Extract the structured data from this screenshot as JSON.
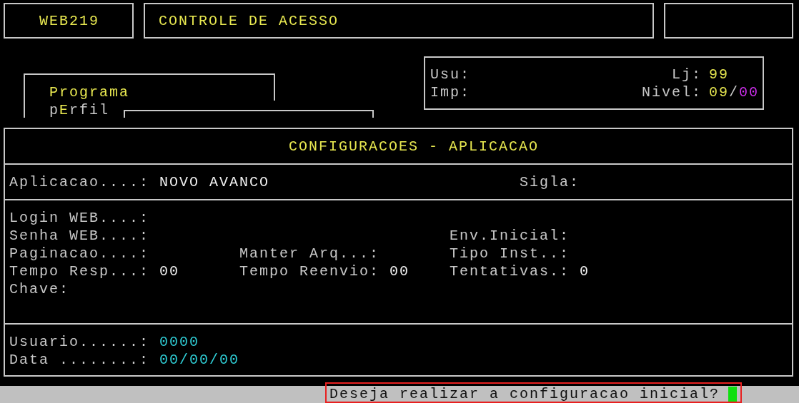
{
  "header": {
    "program_code": "WEB219",
    "title": "CONTROLE DE ACESSO"
  },
  "tabs": [
    {
      "hotkey": "P",
      "after": "rograma",
      "selected": true
    },
    {
      "before": "p",
      "hotkey": "E",
      "after": "rfil",
      "selected": false
    }
  ],
  "session_info": {
    "rows": [
      {
        "label": "Usu:",
        "right_label": "Lj:",
        "right_value": [
          {
            "text": "99",
            "color": "#e8e850"
          }
        ]
      },
      {
        "label": "Imp:",
        "right_label": "Nivel:",
        "right_value": [
          {
            "text": "09",
            "color": "#e8e850"
          },
          {
            "text": "/",
            "color": "#c8c8c8"
          },
          {
            "text": "00",
            "color": "#d030f0"
          }
        ]
      }
    ]
  },
  "panel": {
    "title": "CONFIGURACOES - APLICACAO",
    "application": {
      "label": "Aplicacao....:",
      "value": "NOVO AVANCO",
      "sigla_label": "Sigla:"
    },
    "fields": [
      {
        "column_1": {
          "label": "Login WEB....:"
        }
      },
      {
        "column_1": {
          "label": "Senha WEB....:"
        },
        "column_3": {
          "label": "Env.Inicial:"
        }
      },
      {
        "column_1": {
          "label": "Paginacao....:"
        },
        "column_2": {
          "label": "Manter Arq...:"
        },
        "column_3": {
          "label": "Tipo Inst..:"
        }
      },
      {
        "column_1": {
          "label": "Tempo Resp...:",
          "value": "00",
          "color": "#f0f0f0"
        },
        "column_2": {
          "label": "Tempo Reenvio:",
          "value": "00",
          "color": "#f0f0f0"
        },
        "column_3": {
          "label": "Tentativas.:",
          "value": "0",
          "color": "#f0f0f0"
        }
      },
      {
        "column_1": {
          "label": "Chave:"
        }
      }
    ],
    "audit": [
      {
        "label": "Usuario......:",
        "value": "0000",
        "color": "#30d0d8"
      },
      {
        "label": "Data ........:",
        "value": "00/00/00",
        "color": "#30d0d8"
      }
    ]
  },
  "status_bar": {
    "prompt": "Deseja realizar a configuracao inicial?"
  }
}
